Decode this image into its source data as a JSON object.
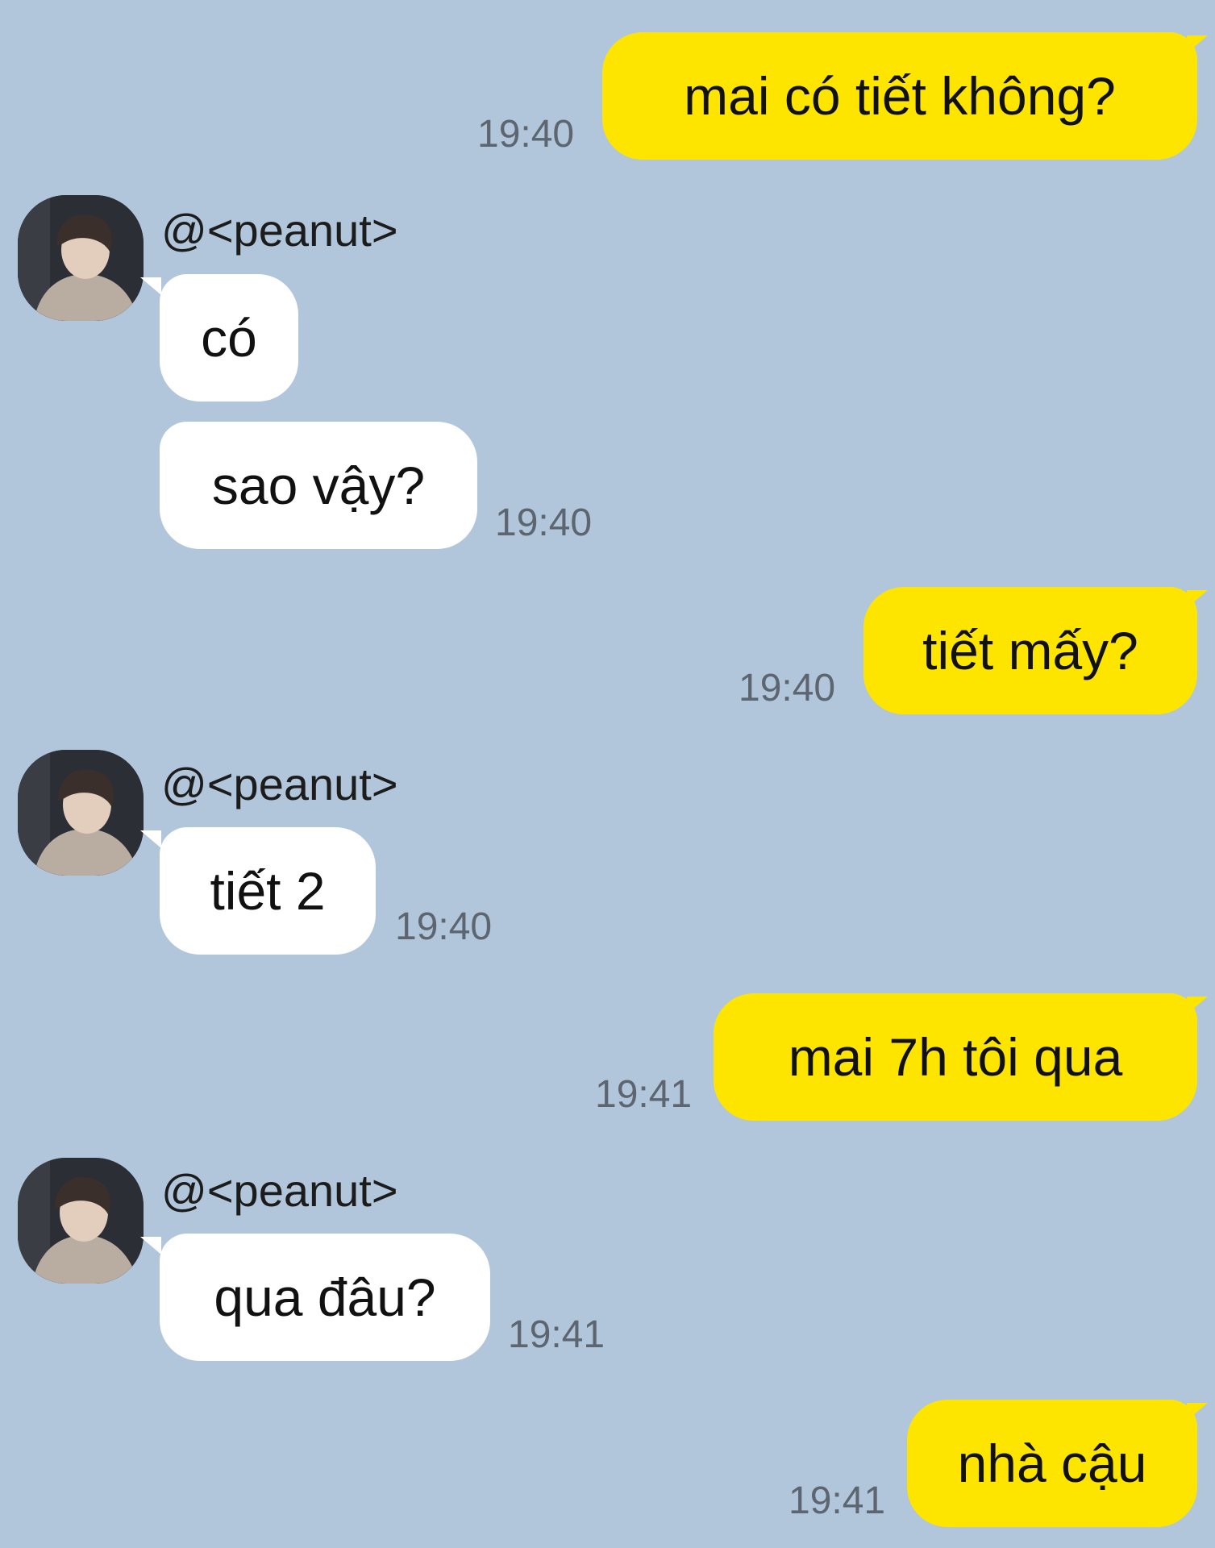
{
  "theme": {
    "background": "#b1c6da",
    "my_bubble": "#fee500",
    "peer_bubble": "#ffffff",
    "timestamp_color": "#5d6670"
  },
  "peer": {
    "name": "@<peanut>",
    "avatar_icon": "profile-photo"
  },
  "messages": [
    {
      "sender": "me",
      "text": "mai có tiết không?",
      "time": "19:40"
    },
    {
      "sender": "peer",
      "text": "có"
    },
    {
      "sender": "peer",
      "text": "sao vậy?",
      "time": "19:40"
    },
    {
      "sender": "me",
      "text": "tiết mấy?",
      "time": "19:40"
    },
    {
      "sender": "peer",
      "text": "tiết 2",
      "time": "19:40"
    },
    {
      "sender": "me",
      "text": "mai 7h tôi qua",
      "time": "19:41"
    },
    {
      "sender": "peer",
      "text": "qua đâu?",
      "time": "19:41"
    },
    {
      "sender": "me",
      "text": "nhà cậu",
      "time": "19:41"
    }
  ]
}
